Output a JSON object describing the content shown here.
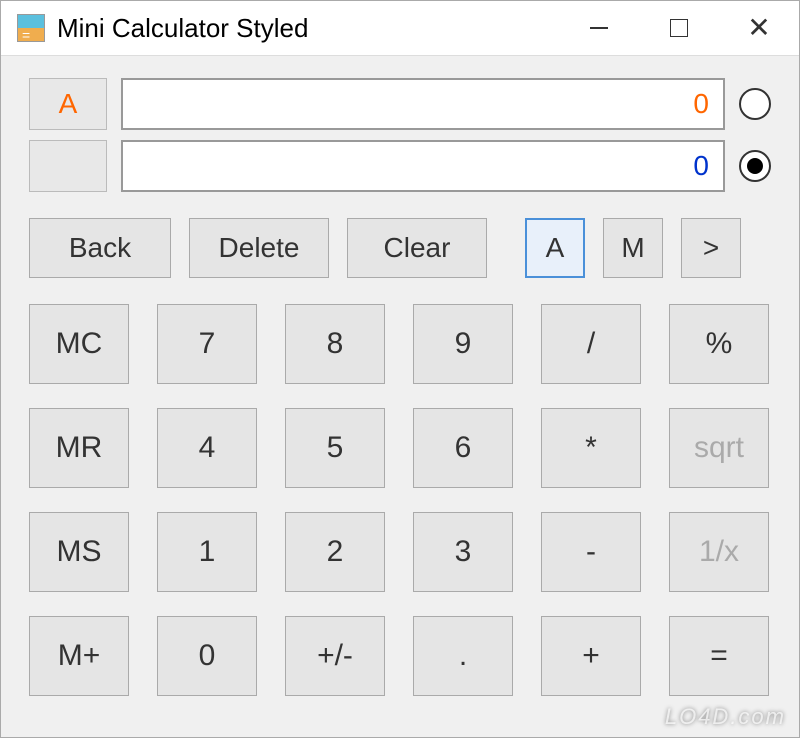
{
  "window": {
    "title": "Mini Calculator Styled"
  },
  "display": {
    "labelA": "A",
    "labelB": "",
    "valueA": "0",
    "valueB": "0",
    "radioASelected": false,
    "radioBSelected": true
  },
  "actions": {
    "back": "Back",
    "delete": "Delete",
    "clear": "Clear",
    "a": "A",
    "m": "M",
    "gt": ">"
  },
  "keypad": {
    "mc": "MC",
    "mr": "MR",
    "ms": "MS",
    "mplus": "M+",
    "n7": "7",
    "n8": "8",
    "n9": "9",
    "n4": "4",
    "n5": "5",
    "n6": "6",
    "n1": "1",
    "n2": "2",
    "n3": "3",
    "n0": "0",
    "plusminus": "+/-",
    "dot": ".",
    "divide": "/",
    "multiply": "*",
    "minus": "-",
    "plus": "+",
    "percent": "%",
    "sqrt": "sqrt",
    "reciprocal": "1/x",
    "equals": "="
  },
  "watermark": "LO4D.com"
}
